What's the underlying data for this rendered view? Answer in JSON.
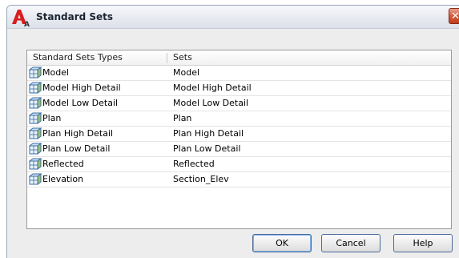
{
  "window": {
    "title": "Standard Sets",
    "close_glyph": "✕",
    "app_icon": "autocad-a-icon"
  },
  "list": {
    "columns": [
      "Standard Sets Types",
      "Sets"
    ],
    "rows": [
      {
        "type": "Model",
        "set": "Model"
      },
      {
        "type": "Model High Detail",
        "set": "Model High Detail"
      },
      {
        "type": "Model Low Detail",
        "set": "Model Low Detail"
      },
      {
        "type": "Plan",
        "set": "Plan"
      },
      {
        "type": "Plan High Detail",
        "set": "Plan High Detail"
      },
      {
        "type": "Plan Low Detail",
        "set": "Plan Low Detail"
      },
      {
        "type": "Reflected",
        "set": "Reflected"
      },
      {
        "type": "Elevation",
        "set": "Section_Elev"
      }
    ],
    "row_icon": "display-set-icon"
  },
  "buttons": {
    "ok": "OK",
    "cancel": "Cancel",
    "help": "Help"
  },
  "colors": {
    "close_button": "#c2391c",
    "accent_border": "#4a6a9a"
  }
}
